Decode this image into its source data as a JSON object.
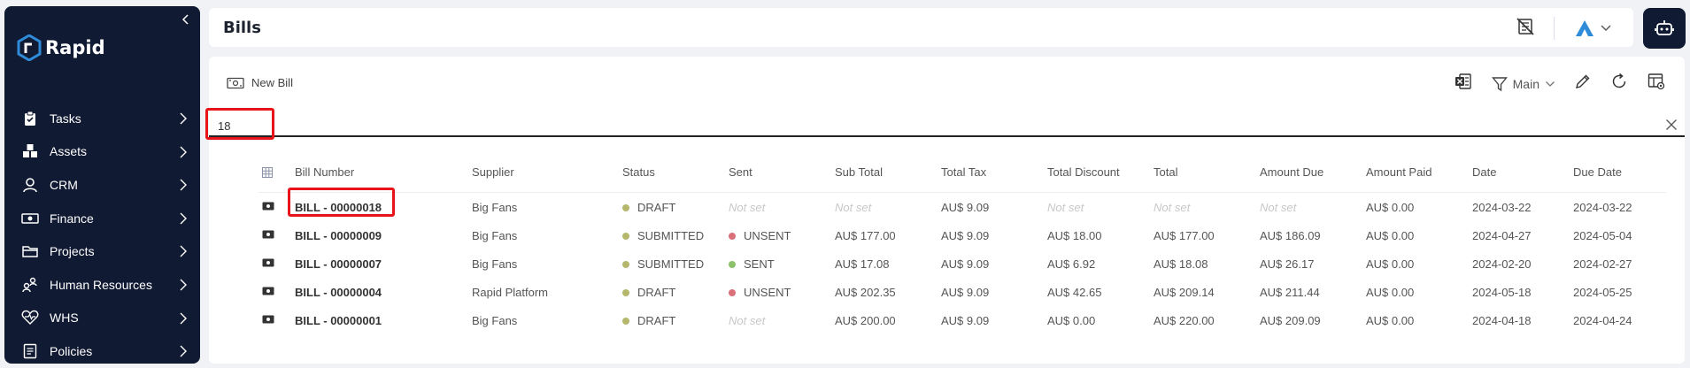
{
  "app": {
    "name": "Rapid"
  },
  "sidebar": {
    "items": [
      {
        "label": "Tasks",
        "icon": "clipboard-check-icon"
      },
      {
        "label": "Assets",
        "icon": "boxes-icon"
      },
      {
        "label": "CRM",
        "icon": "person-icon"
      },
      {
        "label": "Finance",
        "icon": "banknote-icon"
      },
      {
        "label": "Projects",
        "icon": "folder-icon"
      },
      {
        "label": "Human Resources",
        "icon": "people-tree-icon"
      },
      {
        "label": "WHS",
        "icon": "heart-pulse-icon"
      },
      {
        "label": "Policies",
        "icon": "document-icon"
      }
    ]
  },
  "header": {
    "title": "Bills"
  },
  "toolbar": {
    "new_bill_label": "New Bill",
    "view_label": "Main"
  },
  "search": {
    "value": "18"
  },
  "table": {
    "columns": [
      "Bill Number",
      "Supplier",
      "Status",
      "Sent",
      "Sub Total",
      "Total Tax",
      "Total Discount",
      "Total",
      "Amount Due",
      "Amount Paid",
      "Date",
      "Due Date"
    ],
    "not_set_text": "Not set",
    "rows": [
      {
        "bill_number": "BILL - 00000018",
        "supplier": "Big Fans",
        "status": "DRAFT",
        "sent": "Not set",
        "sub_total": "Not set",
        "total_tax": "AU$ 9.09",
        "total_discount": "Not set",
        "total": "Not set",
        "amount_due": "Not set",
        "amount_paid": "AU$ 0.00",
        "date": "2024-03-22",
        "due_date": "2024-03-22"
      },
      {
        "bill_number": "BILL - 00000009",
        "supplier": "Big Fans",
        "status": "SUBMITTED",
        "sent": "UNSENT",
        "sub_total": "AU$ 177.00",
        "total_tax": "AU$ 9.09",
        "total_discount": "AU$ 18.00",
        "total": "AU$ 177.00",
        "amount_due": "AU$ 186.09",
        "amount_paid": "AU$ 0.00",
        "date": "2024-04-27",
        "due_date": "2024-05-04"
      },
      {
        "bill_number": "BILL - 00000007",
        "supplier": "Big Fans",
        "status": "SUBMITTED",
        "sent": "SENT",
        "sub_total": "AU$ 17.08",
        "total_tax": "AU$ 9.09",
        "total_discount": "AU$ 6.92",
        "total": "AU$ 18.08",
        "amount_due": "AU$ 26.17",
        "amount_paid": "AU$ 0.00",
        "date": "2024-02-20",
        "due_date": "2024-02-27"
      },
      {
        "bill_number": "BILL - 00000004",
        "supplier": "Rapid Platform",
        "status": "DRAFT",
        "sent": "UNSENT",
        "sub_total": "AU$ 202.35",
        "total_tax": "AU$ 9.09",
        "total_discount": "AU$ 42.65",
        "total": "AU$ 209.14",
        "amount_due": "AU$ 211.44",
        "amount_paid": "AU$ 0.00",
        "date": "2024-05-18",
        "due_date": "2024-05-25"
      },
      {
        "bill_number": "BILL - 00000001",
        "supplier": "Big Fans",
        "status": "DRAFT",
        "sent": "Not set",
        "sub_total": "AU$ 200.00",
        "total_tax": "AU$ 9.09",
        "total_discount": "AU$ 0.00",
        "total": "AU$ 220.00",
        "amount_due": "AU$ 209.09",
        "amount_paid": "AU$ 0.00",
        "date": "2024-04-18",
        "due_date": "2024-04-24"
      }
    ]
  },
  "colors": {
    "sidebar_bg": "#111a33",
    "accent": "#2e8bd8",
    "highlight": "#e8141a",
    "status_draft": "#b5b86a",
    "status_submitted": "#b5b86a",
    "sent_unsent": "#d9707a",
    "sent_sent": "#8cc06a"
  }
}
